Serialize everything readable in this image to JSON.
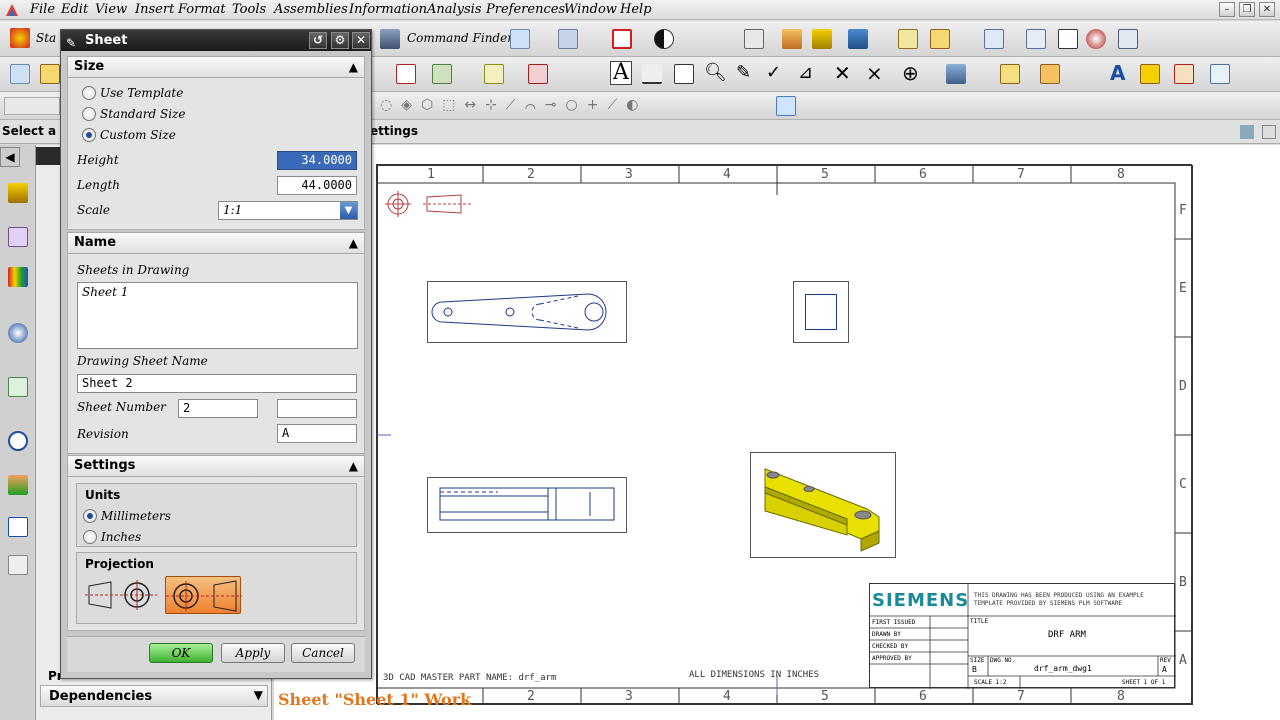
{
  "menubar": {
    "items": [
      "File",
      "Edit",
      "View",
      "Insert",
      "Format",
      "Tools",
      "Assemblies",
      "Information",
      "Analysis",
      "Preferences",
      "Window",
      "Help"
    ]
  },
  "toolbar": {
    "start_partial": "Sta",
    "command_finder": "Command Finder"
  },
  "selection_bar": {
    "label": "Select a"
  },
  "breadcrumb": {
    "settings": "ettings"
  },
  "dialog": {
    "title": "Sheet",
    "size_section": {
      "title": "Size",
      "options": [
        "Use Template",
        "Standard Size",
        "Custom Size"
      ],
      "height_label": "Height",
      "height_value": "34.0000",
      "length_label": "Length",
      "length_value": "44.0000",
      "scale_label": "Scale",
      "scale_value": "1:1"
    },
    "name_section": {
      "title": "Name",
      "sheets_label": "Sheets in Drawing",
      "sheets": [
        "Sheet 1"
      ],
      "sheet_name_label": "Drawing Sheet Name",
      "sheet_name_value": "Sheet 2",
      "sheet_number_label": "Sheet Number",
      "sheet_number_value": "2",
      "sheet_number_extra": "",
      "revision_label": "Revision",
      "revision_value": "A"
    },
    "settings_section": {
      "title": "Settings",
      "units_label": "Units",
      "units": [
        "Millimeters",
        "Inches"
      ],
      "projection_label": "Projection"
    },
    "buttons": {
      "ok": "OK",
      "apply": "Apply",
      "cancel": "Cancel"
    }
  },
  "navigator": {
    "dependencies": "Dependencies",
    "pr": "Pr"
  },
  "drawing": {
    "columns": [
      "1",
      "2",
      "3",
      "4",
      "5",
      "6",
      "7",
      "8"
    ],
    "rows": [
      "F",
      "E",
      "D",
      "C",
      "B",
      "A"
    ],
    "sheet_caption": "Sheet \"Sheet 1\" Work",
    "part_name_note": "3D CAD MASTER PART NAME: drf_arm",
    "dims_note": "ALL DIMENSIONS IN INCHES",
    "title_block": {
      "company": "SIEMENS",
      "disclaimer": "THIS DRAWING HAS BEEN PRODUCED USING AN EXAMPLE TEMPLATE PROVIDED BY SIEMENS PLM SOFTWARE",
      "title_label": "TITLE",
      "title": "DRF ARM",
      "first_issued": "FIRST ISSUED",
      "drawn_by": "DRAWN BY",
      "checked_by": "CHECKED BY",
      "approved_by": "APPROVED BY",
      "size_label": "SIZE",
      "size": "B",
      "dwg_no_label": "DWG NO.",
      "dwg_no": "drf_arm_dwg1",
      "rev_label": "REV",
      "rev": "A",
      "scale": "SCALE 1:2",
      "sheet": "SHEET 1 OF 1"
    }
  },
  "colors": {
    "accent": "#1a4fa0",
    "part": "#e8e000",
    "sheet_caption": "#e07820"
  }
}
